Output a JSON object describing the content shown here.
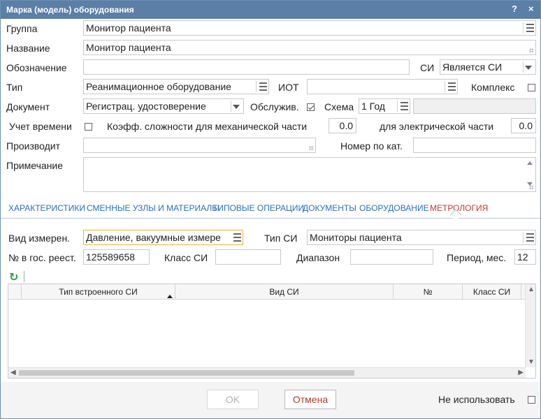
{
  "window": {
    "title": "Марка (модель) оборудования",
    "help_label": "?",
    "close_label": "×"
  },
  "fields": {
    "group": {
      "label": "Группа",
      "value": "Монитор пациента"
    },
    "name": {
      "label": "Название",
      "value": "Монитор пациента"
    },
    "designation": {
      "label": "Обозначение",
      "value": ""
    },
    "si": {
      "label": "СИ",
      "value": "Является СИ"
    },
    "type": {
      "label": "Тип",
      "value": "Реанимационное оборудование"
    },
    "iot": {
      "label": "ИОТ",
      "value": ""
    },
    "complex": {
      "label": "Комплекс",
      "checked": false
    },
    "document": {
      "label": "Документ",
      "value": "Регистрац. удостоверение"
    },
    "service": {
      "label": "Обслужив.",
      "checked": true
    },
    "scheme": {
      "label": "Схема",
      "value": "1 Год",
      "extra": ""
    },
    "time_account": {
      "label": "Учет времени",
      "checked": false
    },
    "mech_coef": {
      "label": "Коэфф. сложности для механической части",
      "value": "0.0"
    },
    "elec_coef": {
      "label": "для электрической части",
      "value": "0.0"
    },
    "producer": {
      "label": "Производит",
      "value": ""
    },
    "catalog_no": {
      "label": "Номер по кат.",
      "value": ""
    },
    "note": {
      "label": "Примечание",
      "value": ""
    }
  },
  "tabs": [
    {
      "label": "ХАРАКТЕРИСТИКИ",
      "active": false
    },
    {
      "label": "СМЕННЫЕ УЗЛЫ И МАТЕРИАЛЫ",
      "active": false
    },
    {
      "label": "ТИПОВЫЕ ОПЕРАЦИИ",
      "active": false
    },
    {
      "label": "ДОКУМЕНТЫ",
      "active": false
    },
    {
      "label": "ОБОРУДОВАНИЕ",
      "active": false
    },
    {
      "label": "МЕТРОЛОГИЯ",
      "active": true
    }
  ],
  "metrology": {
    "measure_kind": {
      "label": "Вид измерен.",
      "value": "Давление, вакуумные измере"
    },
    "si_type": {
      "label": "Тип СИ",
      "value": "Мониторы пациента"
    },
    "registry_no": {
      "label": "№ в гос. реест.",
      "value": "125589658"
    },
    "si_class": {
      "label": "Класс СИ",
      "value": ""
    },
    "range": {
      "label": "Диапазон",
      "value": ""
    },
    "period": {
      "label": "Период, мес.",
      "value": "12"
    }
  },
  "grid": {
    "columns": [
      "Тип встроенного СИ",
      "Вид СИ",
      "№",
      "Класс СИ"
    ],
    "rows": []
  },
  "footer": {
    "ok_label": "OK",
    "cancel_label": "Отмена",
    "not_use_label": "Не использовать",
    "not_use_checked": false
  },
  "colors": {
    "titlebar": "#5b7fa6",
    "tab_link": "#2a6fb4",
    "tab_active": "#c0392b",
    "refresh_icon": "#2e9b3a"
  },
  "icons": {
    "refresh": "refresh-icon",
    "list": "list-icon",
    "dropdown": "chevron-down-icon"
  }
}
